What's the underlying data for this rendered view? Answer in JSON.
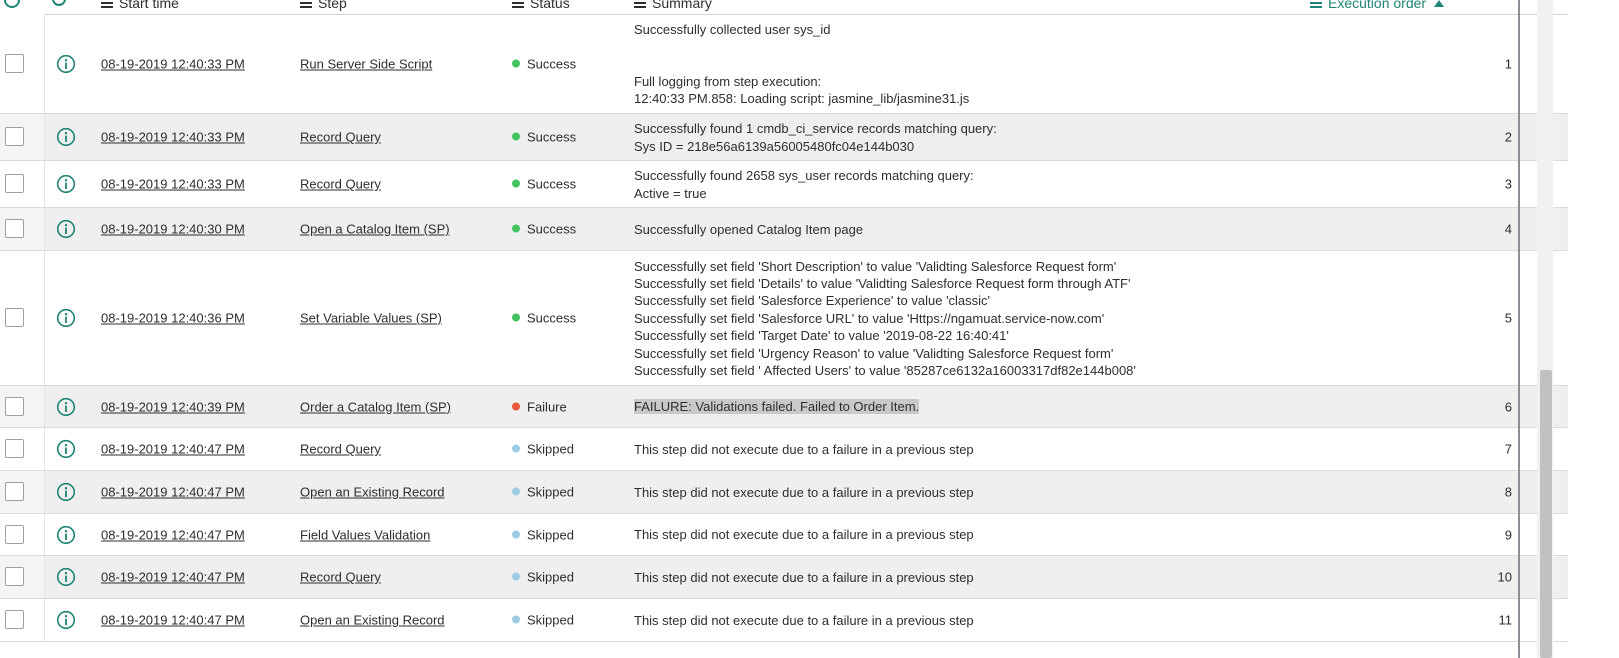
{
  "header": {
    "start_time": "Start time",
    "step": "Step",
    "status": "Status",
    "summary": "Summary",
    "execution_order": "Execution order"
  },
  "colors": {
    "success": "#43c35e",
    "failure": "#e8583a",
    "skipped": "#9ecbe4",
    "accent": "#1f8476"
  },
  "rows": [
    {
      "start": "08-19-2019 12:40:33 PM",
      "step": "Run Server Side Script",
      "status": "Success",
      "summary": [
        "Successfully collected user sys_id",
        "",
        "",
        "Full logging from step execution:",
        "12:40:33 PM.858: Loading script: jasmine_lib/jasmine31.js"
      ],
      "order": "1"
    },
    {
      "start": "08-19-2019 12:40:33 PM",
      "step": "Record Query",
      "status": "Success",
      "summary": [
        "Successfully found 1 cmdb_ci_service records matching query:",
        "Sys ID = 218e56a6139a56005480fc04e144b030"
      ],
      "order": "2"
    },
    {
      "start": "08-19-2019 12:40:33 PM",
      "step": "Record Query",
      "status": "Success",
      "summary": [
        "Successfully found 2658 sys_user records matching query:",
        "Active = true"
      ],
      "order": "3"
    },
    {
      "start": "08-19-2019 12:40:30 PM",
      "step": "Open a Catalog Item (SP)",
      "status": "Success",
      "summary": [
        "Successfully opened Catalog Item page"
      ],
      "order": "4"
    },
    {
      "start": "08-19-2019 12:40:36 PM",
      "step": "Set Variable Values (SP)",
      "status": "Success",
      "summary": [
        "Successfully set field 'Short Description' to value 'Validting Salesforce Request form'",
        "Successfully set field 'Details' to value 'Validting Salesforce Request form through ATF'",
        "Successfully set field 'Salesforce Experience' to value 'classic'",
        "Successfully set field 'Salesforce URL' to value 'Https://ngamuat.service-now.com'",
        "Successfully set field 'Target Date' to value '2019-08-22 16:40:41'",
        "Successfully set field 'Urgency Reason' to value 'Validting Salesforce Request form'",
        "Successfully set field ' Affected Users' to value '85287ce6132a16003317df82e144b008'"
      ],
      "order": "5"
    },
    {
      "start": "08-19-2019 12:40:39 PM",
      "step": "Order a Catalog Item (SP)",
      "status": "Failure",
      "summary": [
        "FAILURE: Validations failed. Failed to Order Item."
      ],
      "order": "6"
    },
    {
      "start": "08-19-2019 12:40:47 PM",
      "step": "Record Query",
      "status": "Skipped",
      "summary": [
        "This step did not execute due to a failure in a previous step"
      ],
      "order": "7"
    },
    {
      "start": "08-19-2019 12:40:47 PM",
      "step": "Open an Existing Record",
      "status": "Skipped",
      "summary": [
        "This step did not execute due to a failure in a previous step"
      ],
      "order": "8"
    },
    {
      "start": "08-19-2019 12:40:47 PM",
      "step": "Field Values Validation",
      "status": "Skipped",
      "summary": [
        "This step did not execute due to a failure in a previous step"
      ],
      "order": "9"
    },
    {
      "start": "08-19-2019 12:40:47 PM",
      "step": "Record Query",
      "status": "Skipped",
      "summary": [
        "This step did not execute due to a failure in a previous step"
      ],
      "order": "10"
    },
    {
      "start": "08-19-2019 12:40:47 PM",
      "step": "Open an Existing Record",
      "status": "Skipped",
      "summary": [
        "This step did not execute due to a failure in a previous step"
      ],
      "order": "11"
    }
  ]
}
